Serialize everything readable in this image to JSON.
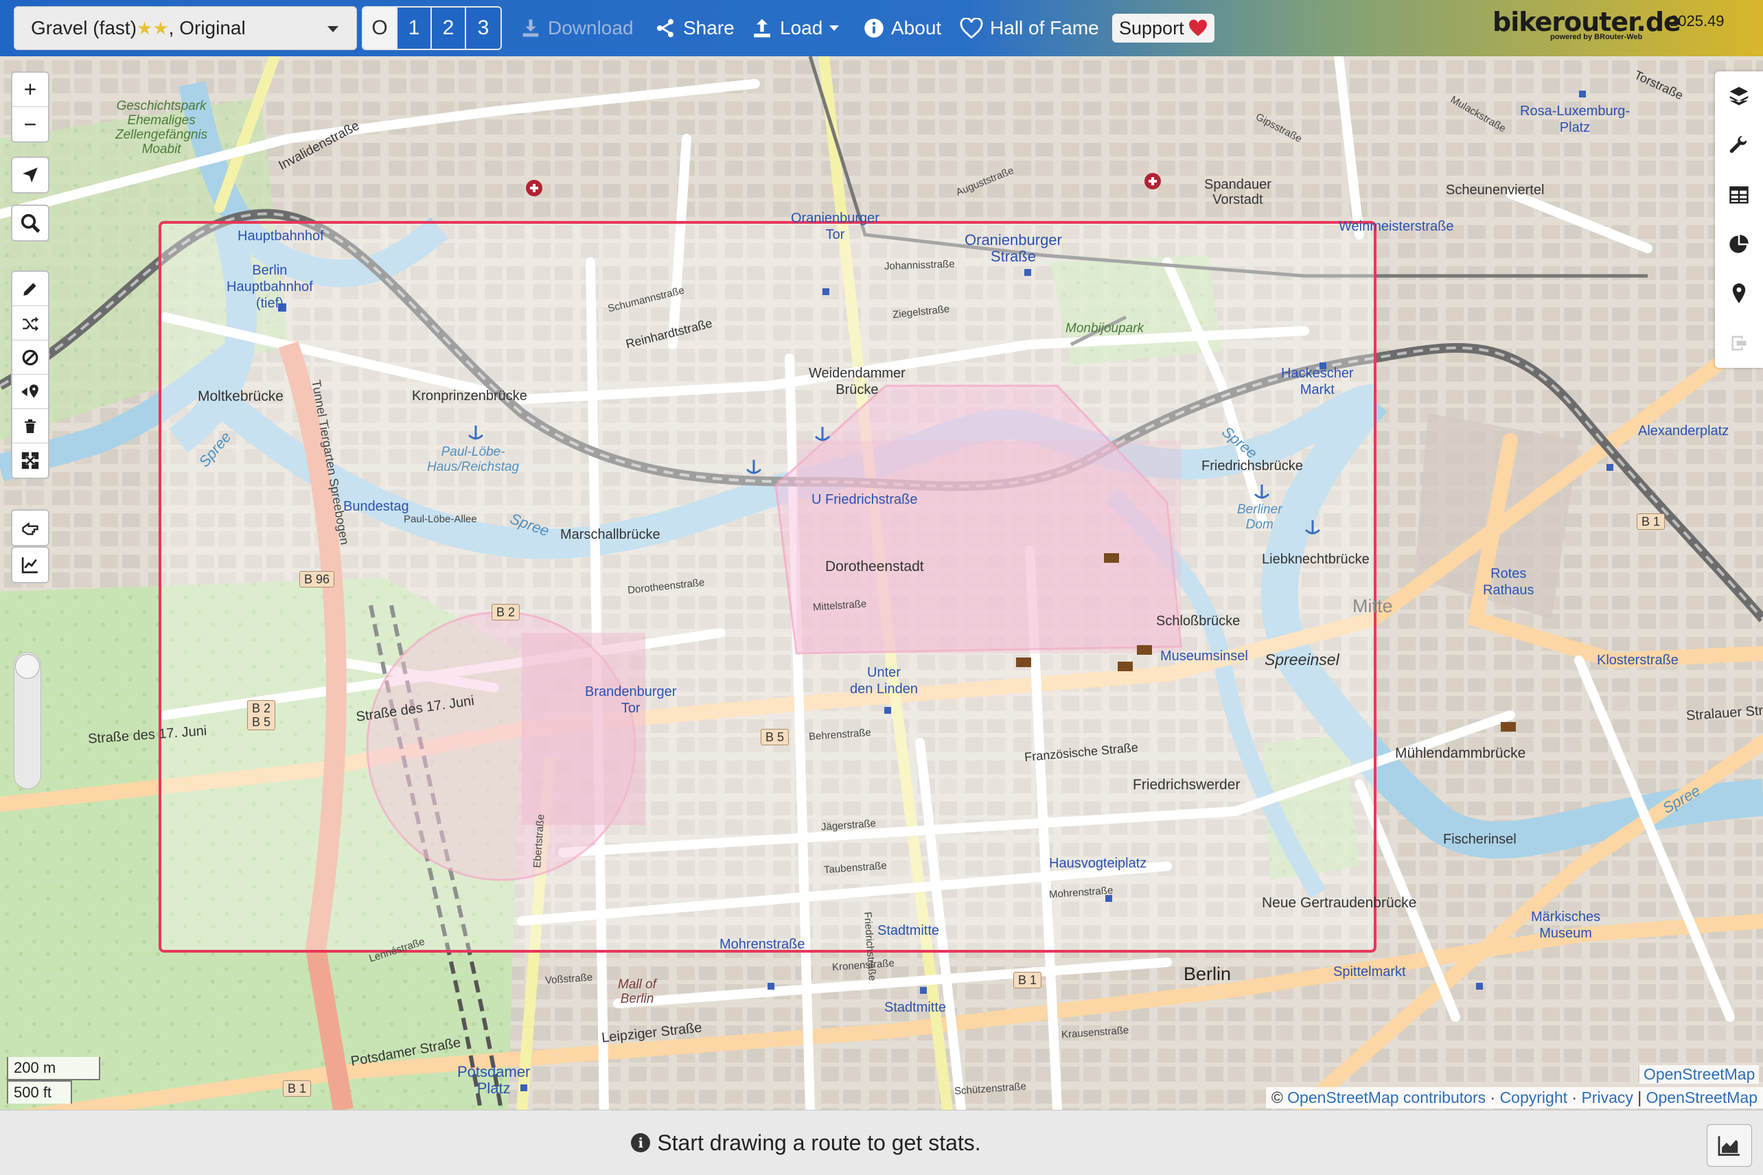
{
  "toolbar": {
    "profile": {
      "text_pre": "Gravel (fast) ",
      "stars": "★★",
      "text_post": ", Original"
    },
    "alternatives": [
      "O",
      "1",
      "2",
      "3"
    ],
    "download_label": "Download",
    "share_label": "Share",
    "load_label": "Load",
    "about_label": "About",
    "hall_label": "Hall of Fame",
    "support_label": "Support",
    "brand": "bikerouter.de",
    "brand_sub": "powered by BRouter-Web",
    "version": "2025.49"
  },
  "map": {
    "labels": {
      "hauptbahnhof": "Hauptbahnhof",
      "berlin_hbf": "Berlin\nHauptbahnhof\n(tief)",
      "oranienburger_tor": "Oranienburger\nTor",
      "oranienburger_str": "Oranienburger\nStraße",
      "weinmeisterstr": "Weinmeisterstraße",
      "rosa": "Rosa-Luxemburg-\nPlatz",
      "hackescher": "Hackescher\nMarkt",
      "alexanderplatz": "Alexanderplatz",
      "friedrichstr": "U Friedrichstraße",
      "bundestag": "Bundestag",
      "brandenburger": "Brandenburger\nTor",
      "unter": "Unter\nden Linden",
      "museumsinsel": "Museumsinsel",
      "rotes": "Rotes\nRathaus",
      "klosterstr": "Klosterstraße",
      "hausvogtei": "Hausvogteiplatz",
      "stadtmitte1": "Stadtmitte",
      "stadtmitte2": "Stadtmitte",
      "mohrenstr": "Mohrenstraße",
      "spittelmarkt": "Spittelmarkt",
      "maerkisches": "Märkisches\nMuseum",
      "potsdamer": "Potsdamer\nPlatz",
      "berlin": "Berlin",
      "mitte": "Mitte",
      "spreeinsel": "Spreeinsel",
      "dorotheenstadt": "Dorotheenstadt",
      "friedrichswerder": "Friedrichswerder",
      "spandauer": "Spandauer\nVorstadt",
      "scheunenviertel": "Scheunenviertel",
      "monbijoupark": "Monbijoupark",
      "geschichtspark": "Geschichtspark\nEhemaliges\nZellengefängnis\nMoabit",
      "moltkebruecke": "Moltkebrücke",
      "kronprinzenbruecke": "Kronprinzenbrücke",
      "marschallbruecke": "Marschallbrücke",
      "weidendammer": "Weidendammer\nBrücke",
      "friedrichsbruecke": "Friedrichsbrücke",
      "liebknecht": "Liebknechtbrücke",
      "schlossbruecke": "Schloßbrücke",
      "muehlendamm": "Mühlendammbrücke",
      "fischerinsel": "Fischerinsel",
      "neue_gertraud": "Neue Gertraudenbrücke",
      "strasse17": "Straße des 17. Juni",
      "strasse17b": "Straße des 17. Juni",
      "potsdamer_str": "Potsdamer Straße",
      "leipziger": "Leipziger Straße",
      "franzoesische": "Französische Straße",
      "invaliden": "Invalidenstraße",
      "reinhardt": "Reinhardtstraße",
      "spree1": "Spree",
      "spree2": "Spree",
      "spree3": "Spree",
      "spree4": "Spree",
      "poul": "Paul-Löbe-\nHaus/Reichstag",
      "berliner_dom": "Berliner\nDom",
      "stralauer": "Stralauer Stra",
      "mall": "Mall of\nBerlin",
      "torstr": "Torstraße",
      "schumann": "Schumannstraße",
      "ziegel": "Ziegelstraße",
      "johannis": "Johannisstraße",
      "mittelstr": "Mittelstraße",
      "dorotheenstr": "Dorotheenstraße",
      "behrenstr": "Behrenstraße",
      "jaegerstr": "Jägerstraße",
      "taubenstr": "Taubenstraße",
      "mohrenstr2": "Mohrenstraße",
      "kronenstr": "Kronenstraße",
      "krausenstr": "Krausenstraße",
      "schuetzenstr": "Schützenstraße",
      "vossstr": "Voßstraße",
      "friedrichstr_street": "Friedrichstraße",
      "ebertstr": "Ebertstraße",
      "tunnel": "Tunnel Tiergarten Spreebogen",
      "lennestr": "Lennéstraße",
      "paulloebe": "Paul-Löbe-Allee",
      "augustr": "Auguststraße",
      "gipsstr": "Gipsstraße",
      "mulack": "Mulackstraße"
    },
    "shields": [
      "B 96",
      "B 2",
      "B 2\nB 5",
      "B 5",
      "B 1",
      "B 1",
      "B 1"
    ]
  },
  "left_controls": {
    "zoom_in": "+",
    "zoom_out": "−"
  },
  "scale": {
    "metric": "200 m",
    "imperial": "500 ft"
  },
  "attribution": {
    "top": "OpenStreetMap",
    "prefix": "© ",
    "osm": "OpenStreetMap contributors",
    "sep1": " · ",
    "copyright": "Copyright",
    "sep2": " · ",
    "privacy": "Privacy",
    "sep3": " | ",
    "osm2": "OpenStreetMap"
  },
  "stats": {
    "message": "Start drawing a route to get stats."
  },
  "colors": {
    "accent": "#2166c4",
    "selection": "#e8375a",
    "area": "#f06aa0"
  }
}
